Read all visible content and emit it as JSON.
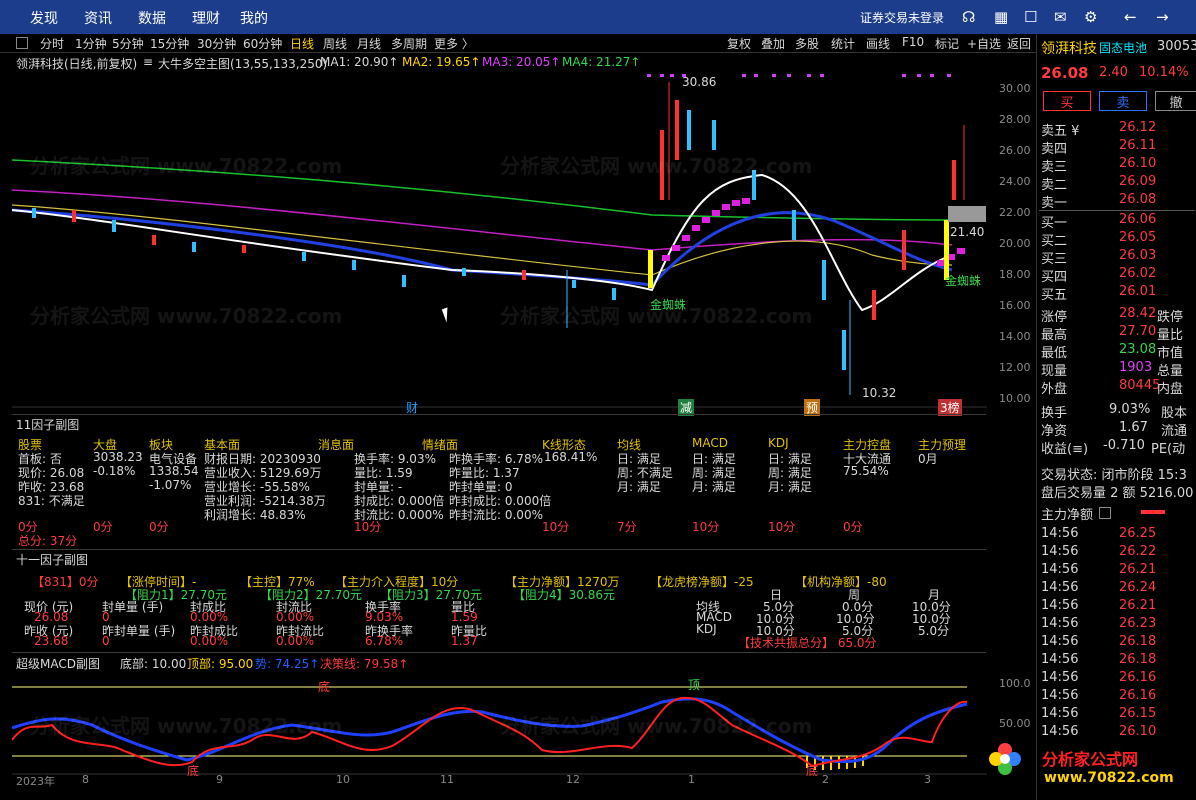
{
  "topnav": [
    "发现",
    "资讯",
    "数据",
    "理财",
    "我的"
  ],
  "login_text": "证券交易未登录",
  "periods": [
    "分时",
    "1分钟",
    "5分钟",
    "15分钟",
    "30分钟",
    "60分钟",
    "日线",
    "周线",
    "月线",
    "多周期",
    "更多 〉"
  ],
  "right_tools": [
    "复权",
    "叠加",
    "多股",
    "统计",
    "画线",
    "F10",
    "标记",
    "+自选",
    "返回"
  ],
  "main_legend": {
    "stock": "领湃科技(日线,前复权)",
    "indicator": "大牛多空主图(13,55,133,250)",
    "ma1": "MA1: 20.90↑",
    "ma2": "MA2: 19.65↑",
    "ma3": "MA3: 20.05↑",
    "ma4": "MA4: 21.27↑"
  },
  "price_axis": [
    "30.00",
    "28.00",
    "26.00",
    "24.00",
    "22.00",
    "20.00",
    "18.00",
    "16.00",
    "14.00",
    "12.00",
    "10.00"
  ],
  "annotations": {
    "high": "30.86",
    "low": "10.32",
    "price_right": "21.40",
    "signal": "金蜘蛛"
  },
  "event_marks": [
    "财",
    "减",
    "预",
    "3榜"
  ],
  "panel1": {
    "title": "11因子副图",
    "headers": [
      "股票",
      "大盘",
      "板块",
      "基本面",
      "消息面",
      "情绪面",
      "K线形态",
      "均线",
      "MACD",
      "KDJ",
      "主力控盘",
      "主力预理"
    ],
    "stock_col": [
      "首板: 否",
      "现价: 26.08",
      "昨收: 23.68",
      "831: 不满足"
    ],
    "dapan_col": [
      "3038.23",
      "-0.18%"
    ],
    "bankuai_col": [
      "电气设备",
      "1338.54",
      "-1.07%"
    ],
    "jiben_col": [
      "财报日期: 20230930",
      "营业收入: 5129.69万",
      "营业增长: -55.58%",
      "营业利润: -5214.38万",
      "利润增长: 48.83%"
    ],
    "xiaoxi_col": [
      "换手率: 9.03%",
      "量比: 1.59",
      "封单量: -",
      "封成比: 0.000倍",
      "封流比: 0.000%"
    ],
    "qingxu_col": [
      "昨换手率: 6.78%",
      "昨量比: 1.37",
      "昨封单量: 0",
      "昨封成比: 0.000倍",
      "昨封流比: 0.00%"
    ],
    "kline_val": "168.41%",
    "ma_col": [
      "日: 满足",
      "周: 不满足",
      "月: 满足"
    ],
    "macd_col": [
      "日: 满足",
      "周: 满足",
      "月: 满足"
    ],
    "kdj_col": [
      "日: 满足",
      "周: 满足",
      "月: 满足"
    ],
    "zhuli_col": [
      "十大流通",
      "75.54%"
    ],
    "yuli_col": [
      "0月"
    ],
    "scores": [
      "0分",
      "0分",
      "0分",
      "10分",
      "10分",
      "7分",
      "10分",
      "10分",
      "0分"
    ],
    "total": "总分: 37分"
  },
  "panel2": {
    "title": "十一因子副图",
    "row1": [
      "【831】0分",
      "【涨停时间】-",
      "【主控】77%",
      "【主力介入程度】10分",
      "【主力净额】1270万",
      "【龙虎榜净额】-25",
      "【机构净额】-80"
    ],
    "row2": [
      "【阻力1】27.70元",
      "【阻力2】27.70元",
      "【阻力3】27.70元",
      "【阻力4】30.86元"
    ],
    "labels_a": [
      "现价 (元)",
      "封单量 (手)",
      "封成比",
      "封流比",
      "换手率",
      "量比"
    ],
    "vals_a": [
      "26.08",
      "0",
      "0.00%",
      "0.00%",
      "9.03%",
      "1.59"
    ],
    "labels_b": [
      "昨收 (元)",
      "昨封单量 (手)",
      "昨封成比",
      "昨封流比",
      "昨换手率",
      "昨量比"
    ],
    "vals_b": [
      "23.68",
      "0",
      "0.00%",
      "0.00%",
      "6.78%",
      "1.37"
    ],
    "tbl_head": [
      "日",
      "周",
      "月"
    ],
    "tbl_rows": [
      [
        "均线",
        "5.0分",
        "0.0分",
        "10.0分"
      ],
      [
        "MACD",
        "10.0分",
        "10.0分",
        "10.0分"
      ],
      [
        "KDJ",
        "10.0分",
        "5.0分",
        "5.0分"
      ]
    ],
    "tech_total": "【技术共振总分】 65.0分"
  },
  "panel3": {
    "title": "超级MACD副图",
    "bottom": "底部: 10.00",
    "top": "顶部: 95.00",
    "buy": "势: 74.25↑",
    "decision": "决策线: 79.58↑",
    "axis": [
      "100.0",
      "50.00"
    ],
    "marks": [
      "底",
      "顶",
      "底",
      "底"
    ]
  },
  "timeline": [
    "2023年",
    "8",
    "9",
    "10",
    "11",
    "12",
    "1",
    "2",
    "3"
  ],
  "side": {
    "name": "领湃科技",
    "concept": "固态电池",
    "code": "30053",
    "price": "26.08",
    "chg": "2.40",
    "pct": "10.14%",
    "buttons": [
      "买",
      "卖",
      "撤"
    ],
    "asks": [
      [
        "卖五 ¥",
        "26.12"
      ],
      [
        "卖四",
        "26.11"
      ],
      [
        "卖三",
        "26.10"
      ],
      [
        "卖二",
        "26.09"
      ],
      [
        "卖一",
        "26.08"
      ]
    ],
    "bids": [
      [
        "买一",
        "26.06"
      ],
      [
        "买二",
        "26.05"
      ],
      [
        "买三",
        "26.03"
      ],
      [
        "买四",
        "26.02"
      ],
      [
        "买五",
        "26.01"
      ]
    ],
    "stats": [
      [
        "涨停",
        "28.42",
        "跌停"
      ],
      [
        "最高",
        "27.70",
        "量比"
      ],
      [
        "最低",
        "23.08",
        "市值"
      ],
      [
        "现量",
        "1903",
        "总量"
      ],
      [
        "外盘",
        "80445",
        "内盘"
      ]
    ],
    "stats2": [
      [
        "换手",
        "9.03%",
        "股本"
      ],
      [
        "净资",
        "1.67",
        "流通"
      ],
      [
        "收益(≡)",
        "-0.710",
        "PE(动"
      ]
    ],
    "trade_state": "交易状态: 闭市阶段 15:3",
    "after": "盘后交易量 2 额 5216.00",
    "net_title": "主力净额",
    "ticks": [
      [
        "14:56",
        "26.25"
      ],
      [
        "14:56",
        "26.22"
      ],
      [
        "14:56",
        "26.21"
      ],
      [
        "14:56",
        "26.24"
      ],
      [
        "14:56",
        "26.21"
      ],
      [
        "14:56",
        "26.23"
      ],
      [
        "14:56",
        "26.18"
      ],
      [
        "14:56",
        "26.18"
      ],
      [
        "14:56",
        "26.16"
      ],
      [
        "14:56",
        "26.16"
      ],
      [
        "14:56",
        "26.15"
      ],
      [
        "14:56",
        "26.10"
      ]
    ]
  },
  "logo": {
    "text": "分析家公式网",
    "url": "www.70822.com"
  },
  "watermark": "分析家公式网 www.70822.com"
}
